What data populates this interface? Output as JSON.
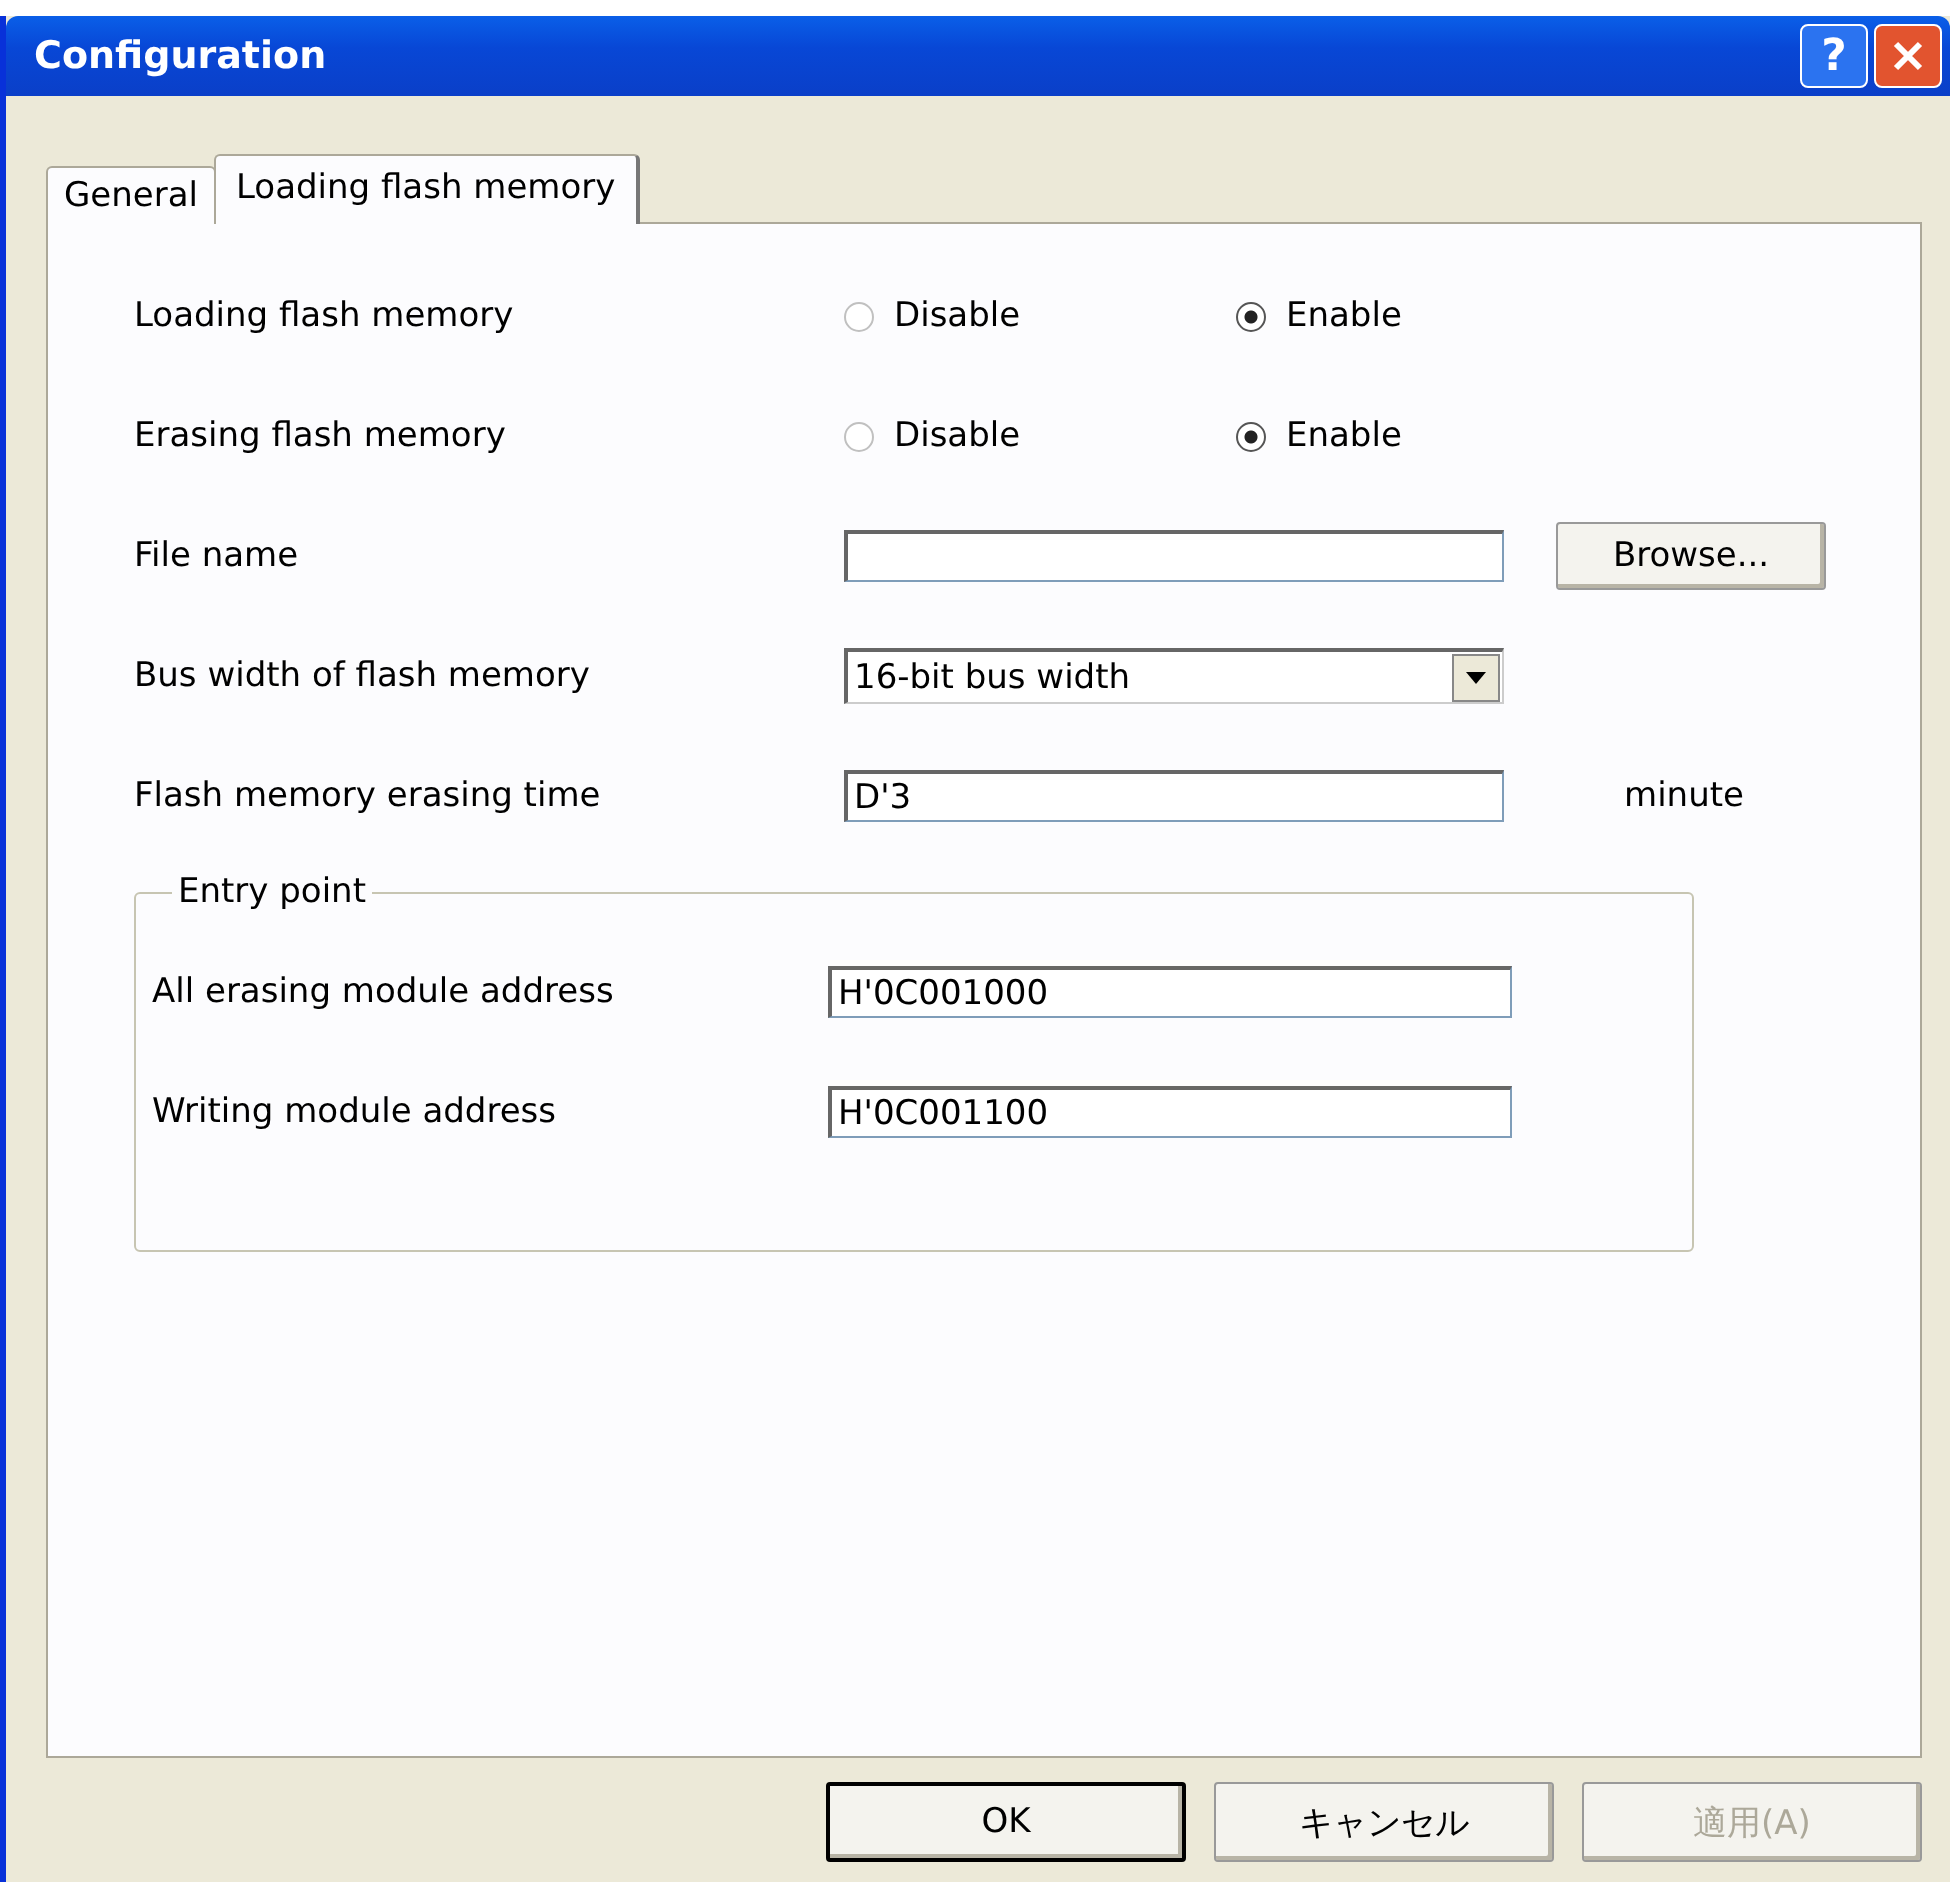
{
  "window": {
    "title": "Configuration",
    "help_button": "?"
  },
  "tabs": [
    {
      "label": "General",
      "selected": false
    },
    {
      "label": "Loading flash memory",
      "selected": true
    }
  ],
  "options": [
    {
      "label": "Loading flash memory",
      "choices": [
        {
          "label": "Disable",
          "selected": false
        },
        {
          "label": "Enable",
          "selected": true
        }
      ]
    },
    {
      "label": "Erasing flash memory",
      "choices": [
        {
          "label": "Disable",
          "selected": false
        },
        {
          "label": "Enable",
          "selected": true
        }
      ]
    }
  ],
  "file_name": {
    "label": "File name",
    "button": "Browse..."
  },
  "bus_width": {
    "label": "Bus width of flash memory",
    "value": "16-bit bus width"
  },
  "erasing_time": {
    "label": "Flash memory erasing time",
    "value": "D'3",
    "unit": "minute"
  },
  "entry_point": {
    "title": "Entry point",
    "fields": [
      {
        "label": "All erasing module address",
        "value": "H'0C001000"
      },
      {
        "label": "Writing module address",
        "value": "H'0C001100"
      }
    ]
  },
  "buttons": [
    {
      "label": "OK",
      "default": true,
      "disabled": false
    },
    {
      "label": "キャンセル",
      "default": false,
      "disabled": false
    },
    {
      "label": "適用(A)",
      "default": false,
      "disabled": true
    }
  ]
}
